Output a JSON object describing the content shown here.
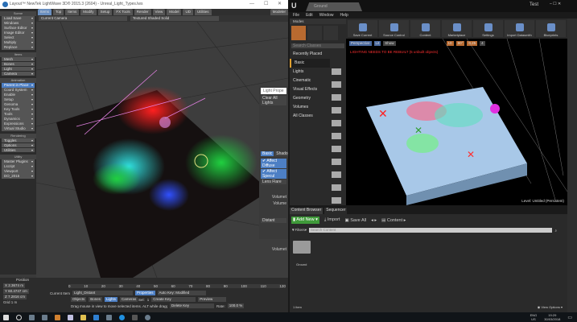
{
  "lightwave": {
    "title": "Layout™ NewTek LightWave 3D® 2015.3 (2604) - Unreal_Light_Types.lws",
    "menu_tabs": [
      "Items",
      "Top",
      "Items",
      "Modify",
      "Setup",
      "FX Tools",
      "Render",
      "View",
      "Model",
      "UD",
      "Utilities"
    ],
    "active_tab": "Items",
    "modeler_label": "Modeler",
    "camera_select": "Current Camera",
    "shading_select": "Textured Shaded Solid",
    "sidebar": [
      {
        "section": "Scene",
        "items": [
          "Load Save",
          "Windows",
          "Surface Editor",
          "Image Editor",
          "Select",
          "Multiply",
          "Replace"
        ]
      },
      {
        "section": "Items",
        "items": [
          "Mesh",
          "Bones",
          "Light",
          "Camera"
        ]
      },
      {
        "section": "Animation",
        "items": [
          "Parent in Place",
          "Coord System",
          "Enable",
          "Setup",
          "Genoma",
          "Key Tools",
          "Tools",
          "Dynamics",
          "Expressions",
          "Virtual Studio"
        ]
      },
      {
        "section": "Rendering",
        "items": [
          "Toggles",
          "Options",
          "Utilities"
        ]
      },
      {
        "section": "Utility",
        "items": [
          "Master Plugins",
          "Lscript",
          "Viewport",
          "DO_2015"
        ]
      }
    ],
    "active_sidebar_item": "Parent in Place",
    "light_panel": {
      "title": "Light Prope",
      "clear_label": "Clear All Lights",
      "tabs": [
        "Basic",
        "Shado"
      ],
      "checks": [
        "Affect Diffuse",
        "Affect Specul"
      ],
      "lens_flare": "Lens Flare",
      "labels": [
        "Volumet",
        "Volume",
        "E"
      ],
      "select": "Distant",
      "footer": "Volumet"
    },
    "bottom": {
      "position_label": "Position",
      "x": "2.3674 m",
      "y": "60.4747 cm",
      "z": "7.2816 cm",
      "grid_label": "Grid",
      "grid_value": "1 m",
      "current_item_label": "Current Item",
      "current_item": "Light_Distant",
      "properties": "Properties",
      "auto_key": "Auto Key: Modified",
      "filters": [
        "Objects",
        "Bones",
        "Lights",
        "Cameras"
      ],
      "sel_label": "Sel:",
      "sel_value": "1",
      "create_key": "Create Key",
      "delete_key": "Delete Key",
      "preview": "Preview",
      "rate_label": "Rate:",
      "rate_value": "100.0 %",
      "status": "Drag mouse in view to move selected items. ALT while dragging s...",
      "ticks": [
        "0",
        "10",
        "20",
        "30",
        "40",
        "50",
        "60",
        "70",
        "80",
        "90",
        "100",
        "110",
        "120"
      ]
    }
  },
  "unreal": {
    "tab_title": "Ground",
    "user": "Test",
    "menu": [
      "File",
      "Edit",
      "Window",
      "Help"
    ],
    "modes_label": "Modes",
    "search_placeholder": "Search Classes",
    "categories": [
      "Recently Placed",
      "Basic",
      "Lights",
      "Cinematic",
      "Visual Effects",
      "Geometry",
      "Volumes",
      "All Classes"
    ],
    "active_category": "Basic",
    "toolbar": [
      "Save Current",
      "Source Control",
      "Content",
      "Marketplace",
      "Settings",
      "Import Datasmith",
      "Blueprints"
    ],
    "viewport": {
      "perspective": "Perspective",
      "lit": "Lit",
      "show": "Show",
      "warning": "LIGHTING NEEDS TO BE REBUILT (5 unbuilt objects)",
      "level_label": "Level: Untitled (Persistent)",
      "fov": "90°",
      "snap": "10",
      "scale": "0.25",
      "cam": "4"
    },
    "content_browser": {
      "tabs": [
        "Content Browser",
        "Sequencer"
      ],
      "add_new": "Add New",
      "import": "Import",
      "save_all": "Save All",
      "path": "Content",
      "filters": "Filters",
      "search_placeholder": "Search Content",
      "folder": "Ground",
      "count": "1 item",
      "view_options": "View Options"
    },
    "warning_color": "#ff3030",
    "accent": "#e0a030"
  },
  "taskbar": {
    "lang": "ENG",
    "region": "US",
    "time": "19:29",
    "date": "30/03/2018"
  }
}
